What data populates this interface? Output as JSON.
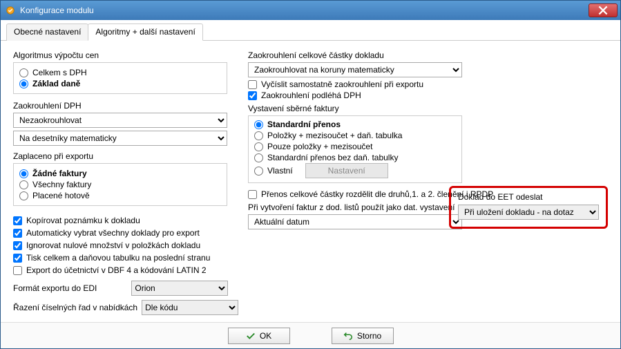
{
  "window": {
    "title": "Konfigurace modulu"
  },
  "tabs": {
    "general": "Obecné nastavení",
    "algs": "Algoritmy + další nastavení"
  },
  "left": {
    "alg_label": "Algoritmus výpočtu cen",
    "alg_opt1": "Celkem s DPH",
    "alg_opt2": "Základ daně",
    "round_dph_label": "Zaokrouhlení DPH",
    "round_dph_sel1": "Nezaokrouhlovat",
    "round_dph_sel2": "Na desetníky matematicky",
    "paid_label": "Zaplaceno při exportu",
    "paid_opt1": "Žádné faktury",
    "paid_opt2": "Všechny faktury",
    "paid_opt3": "Placené hotově",
    "chk1": "Kopírovat poznámku k dokladu",
    "chk2": "Automaticky vybrat všechny doklady pro export",
    "chk3": "Ignorovat nulové množství v položkách dokladu",
    "chk4": "Tisk celkem a daňovou tabulku na poslední stranu",
    "chk5": "Export do účetnictví v DBF 4 a kódování LATIN 2",
    "edi_label": "Formát exportu do EDI",
    "edi_value": "Orion",
    "sort_label": "Řazení číselných řad v nabídkách",
    "sort_value": "Dle kódu"
  },
  "right": {
    "round_total_label": "Zaokrouhlení celkové částky dokladu",
    "round_total_value": "Zaokrouhlovat na koruny matematicky",
    "chk_export_round": "Vyčíslit samostatně zaokrouhlení při exportu",
    "chk_round_dph": "Zaokrouhlení podléhá DPH",
    "collect_label": "Vystavení sběrné faktury",
    "collect_opt1": "Standardní přenos",
    "collect_opt2": "Položky + mezisoučet + daň. tabulka",
    "collect_opt3": "Pouze položky + mezisoučet",
    "collect_opt4": "Standardní přenos bez daň. tabulky",
    "collect_opt5": "Vlastní",
    "settings_btn": "Nastavení",
    "chk_split": "Přenos celkové částky rozdělit dle druhů,1. a 2. členění i RPDP",
    "date_label": "Při vytvoření faktur z dod. listů použít jako dat. vystavení",
    "date_value": "Aktuální datum",
    "eet_label": "Doklad do EET odeslat",
    "eet_value": "Při uložení dokladu - na dotaz"
  },
  "footer": {
    "ok": "OK",
    "storno": "Storno"
  }
}
